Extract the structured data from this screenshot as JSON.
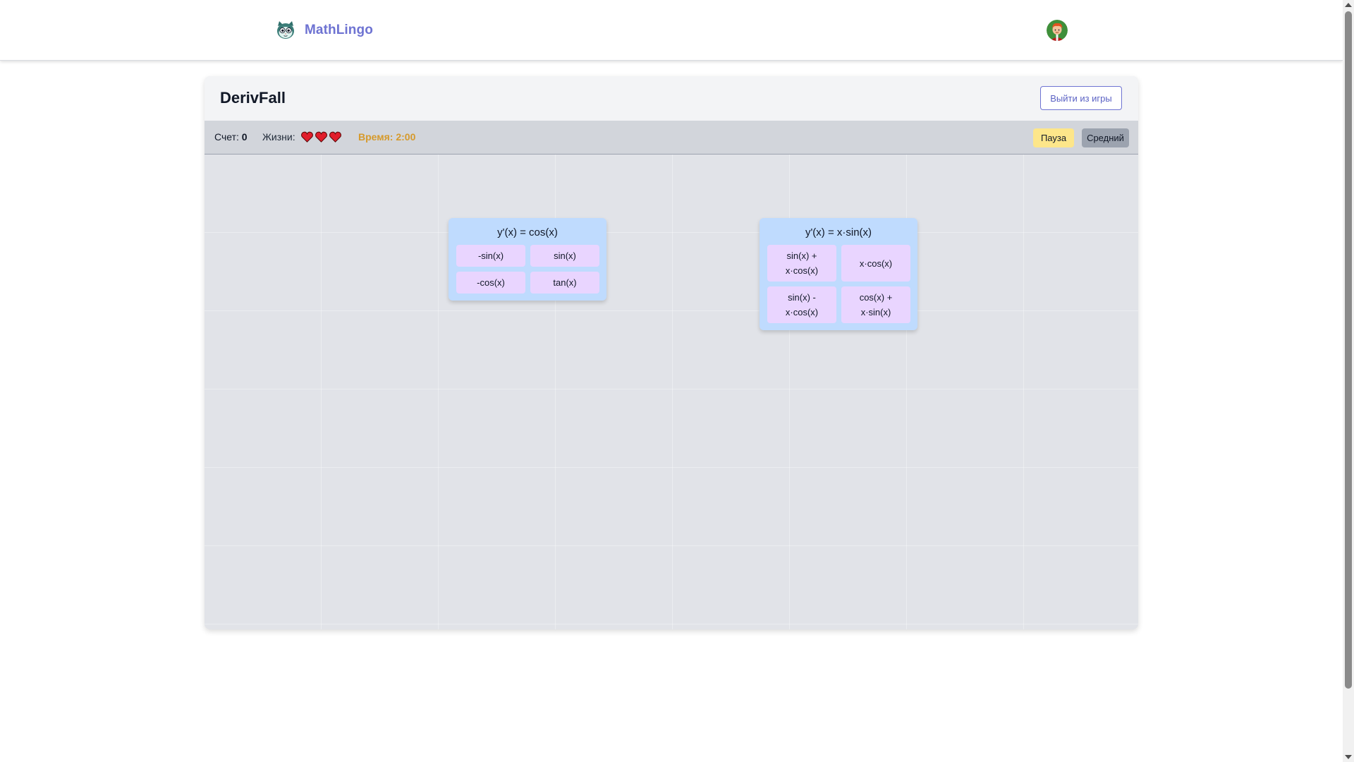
{
  "header": {
    "brand": "MathLingo",
    "logo_icon": "cat-face-icon",
    "avatar_icon": "user-avatar-icon"
  },
  "game": {
    "title": "DerivFall",
    "exit_label": "Выйти из игры",
    "score_label": "Счет:",
    "score_value": "0",
    "lives_label": "Жизни:",
    "lives_count": 3,
    "timer": "Время: 2:00",
    "pause_label": "Пауза",
    "difficulty_label": "Средний",
    "colors": {
      "accent": "#6e73d2",
      "timer": "#d69a2c",
      "heart": "#e11d2b",
      "pause_bg": "#fde68a",
      "problem_bg": "#bfdbfe",
      "answer_bg": "#e9d5ff"
    }
  },
  "problems": [
    {
      "question": "y'(x) = cos(x)",
      "answers": [
        "-sin(x)",
        "sin(x)",
        "-cos(x)",
        "tan(x)"
      ]
    },
    {
      "question": "y'(x) = x·sin(x)",
      "answers": [
        "sin(x) +\nx·cos(x)",
        "x·cos(x)",
        "sin(x) -\nx·cos(x)",
        "cos(x) +\nx·sin(x)"
      ]
    }
  ]
}
